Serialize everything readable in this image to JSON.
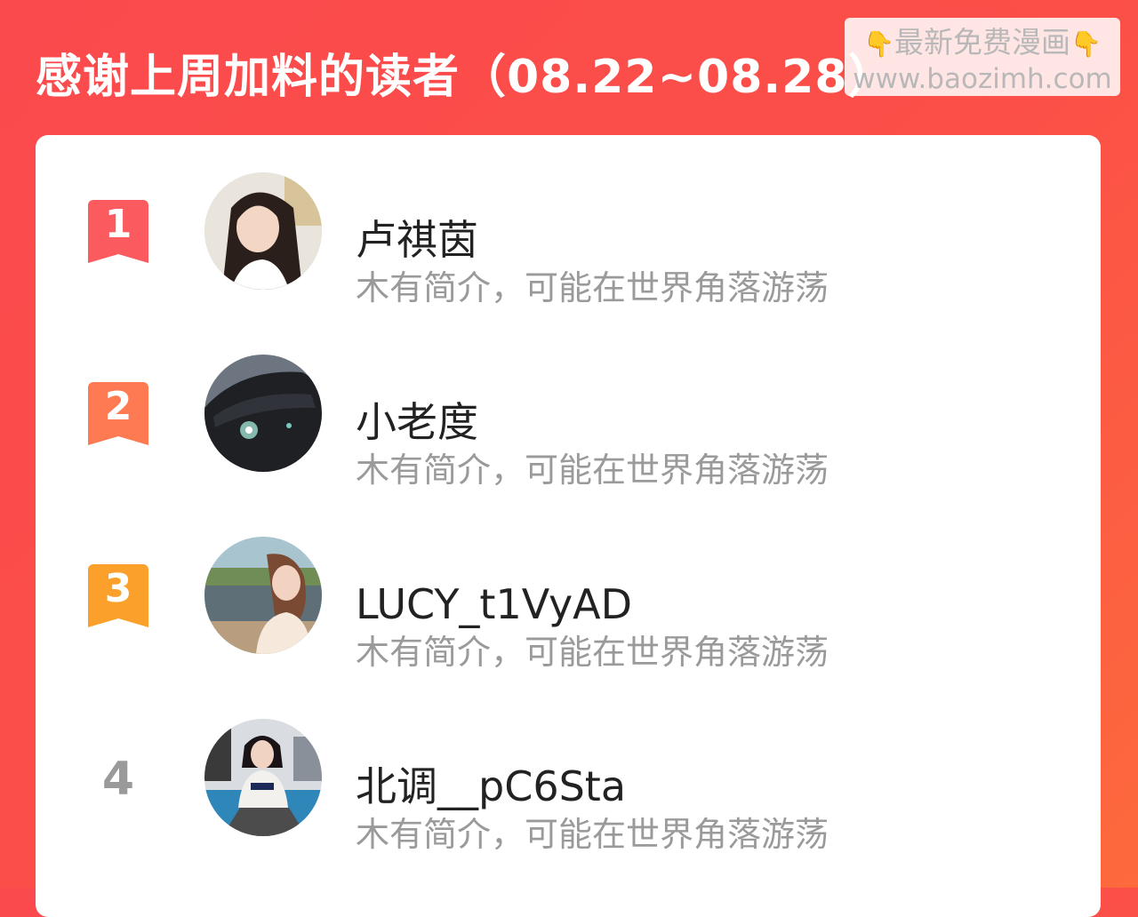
{
  "header": {
    "title": "感谢上周加料的读者（08.22~08.28）"
  },
  "watermark": {
    "line1": "最新免费漫画",
    "line2": "www.baozimh.com",
    "emoji": "👇"
  },
  "colors": {
    "background": "#fb4a4d",
    "rank1": "#fb5a5e",
    "rank2": "#fd7a52",
    "rank3": "#fba02a",
    "rank_plain": "#9a9a9a"
  },
  "readers": [
    {
      "rank": "1",
      "name": "卢祺茵",
      "bio": "木有简介，可能在世界角落游荡",
      "avatar_icon": "avatar-photo-girl"
    },
    {
      "rank": "2",
      "name": "小老度",
      "bio": "木有简介，可能在世界角落游荡",
      "avatar_icon": "avatar-photo-dark-car"
    },
    {
      "rank": "3",
      "name": "LUCY_t1VyAD",
      "bio": "木有简介，可能在世界角落游荡",
      "avatar_icon": "avatar-photo-lake-girl"
    },
    {
      "rank": "4",
      "name": "北调__pC6Sta",
      "bio": "木有简介，可能在世界角落游荡",
      "avatar_icon": "avatar-photo-fila-girl"
    }
  ]
}
